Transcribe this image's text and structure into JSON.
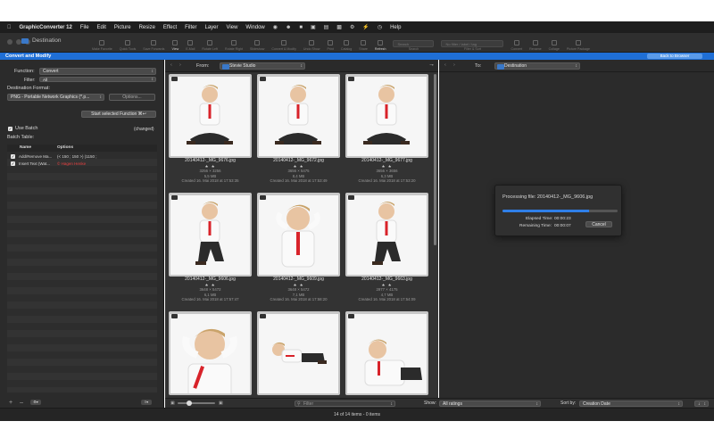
{
  "menubar": {
    "app": "GraphicConverter 12",
    "items": [
      "File",
      "Edit",
      "Picture",
      "Resize",
      "Effect",
      "Filter",
      "Layer",
      "View",
      "Window"
    ],
    "help": "Help"
  },
  "window": {
    "title": "Destination",
    "toolbar": [
      "Make Favorite",
      "Quick Tools",
      "Save Forwards",
      "View",
      "E-Mail",
      "Rotate Left",
      "Rotate Right",
      "Slideshow",
      "Convert & Modify",
      "Undo Show",
      "Print",
      "Catalog",
      "Share",
      "Refresh",
      "Search",
      "Filter & Sort",
      "Convert",
      "Rename",
      "Collage",
      "Picture Package"
    ],
    "search_placeholder": "Search",
    "filter_placeholder": "No filter / label / tag"
  },
  "panel": {
    "title": "Convert and Modify",
    "back_button": "Back to Browser"
  },
  "convert": {
    "function_label": "Function:",
    "function_value": "Convert",
    "filter_label": "Filter:",
    "filter_value": "All",
    "dest_format_label": "Destination Format:",
    "dest_format_value": "PNG - Portable Network Graphics (*.p...",
    "options_button": "Options...",
    "start_button": "Start selected Function",
    "start_shortcut": "⌘↩",
    "use_batch_label": "Use Batch",
    "changed_label": "(changed)",
    "batch_table_label": "Batch Table:",
    "batch_columns": [
      "Name",
      "Options"
    ],
    "batch_rows": [
      {
        "name": "Add/Remove Ma...",
        "options": "(< 150 ; 150 >) (1150 ;",
        "red": false
      },
      {
        "name": "Insert Text (Wat...",
        "options": "© Hagen Henke",
        "red": true
      }
    ],
    "footer_add": "+",
    "footer_remove": "–"
  },
  "browser": {
    "from_label": "From:",
    "from_folder": "Stevie Studio",
    "to_label": "To:",
    "to_folder": "Destination",
    "filter_placeholder": "Filter",
    "show_label": "Show:",
    "show_value": "All ratings",
    "sort_label": "Sort by:",
    "sort_value": "Creation Date"
  },
  "thumbnails": [
    {
      "file": "20140412-_MG_9676.jpg",
      "dims": "3256 × 3256",
      "size": "5,5 MB",
      "created": "Created 16. Mai 2018 at 17:53:35"
    },
    {
      "file": "20140412-_MG_9672.jpg",
      "dims": "3656 × 5475",
      "size": "8,4 MB",
      "created": "Created 16. Mai 2018 at 17:53:49"
    },
    {
      "file": "20140412-_MG_9677.jpg",
      "dims": "3656 × 3656",
      "size": "6,3 MB",
      "created": "Created 16. Mai 2018 at 17:53:20"
    },
    {
      "file": "20140412-_MG_9606.jpg",
      "dims": "3648 × 5472",
      "size": "6,1 MB",
      "created": "Created 16. Mai 2018 at 17:57:47"
    },
    {
      "file": "20140412-_MG_9609.jpg",
      "dims": "3648 × 5472",
      "size": "7,1 MB",
      "created": "Created 16. Mai 2018 at 17:58:20"
    },
    {
      "file": "20140412-_MG_9663.jpg",
      "dims": "2977 × 4175",
      "size": "4,7 MB",
      "created": "Created 16. Mai 2018 at 17:54:09"
    },
    {
      "file": "",
      "dims": "",
      "size": "",
      "created": ""
    },
    {
      "file": "",
      "dims": "",
      "size": "",
      "created": ""
    },
    {
      "file": "",
      "dims": "",
      "size": "",
      "created": ""
    }
  ],
  "stars": "★ ★",
  "progress": {
    "processing": "Processing file: 20140412-_MG_9606.jpg",
    "fraction": 0.75,
    "elapsed_label": "Elapsed Time:",
    "elapsed": "00:00:23",
    "remaining_label": "Remaining Time:",
    "remaining": "00:00:07",
    "cancel": "Cancel"
  },
  "status": {
    "text": "14 of 14 items - 0 items"
  },
  "colors": {
    "accent": "#1f6fd6",
    "progress": "#2f7fe8",
    "watermark_text": "#e84040"
  }
}
